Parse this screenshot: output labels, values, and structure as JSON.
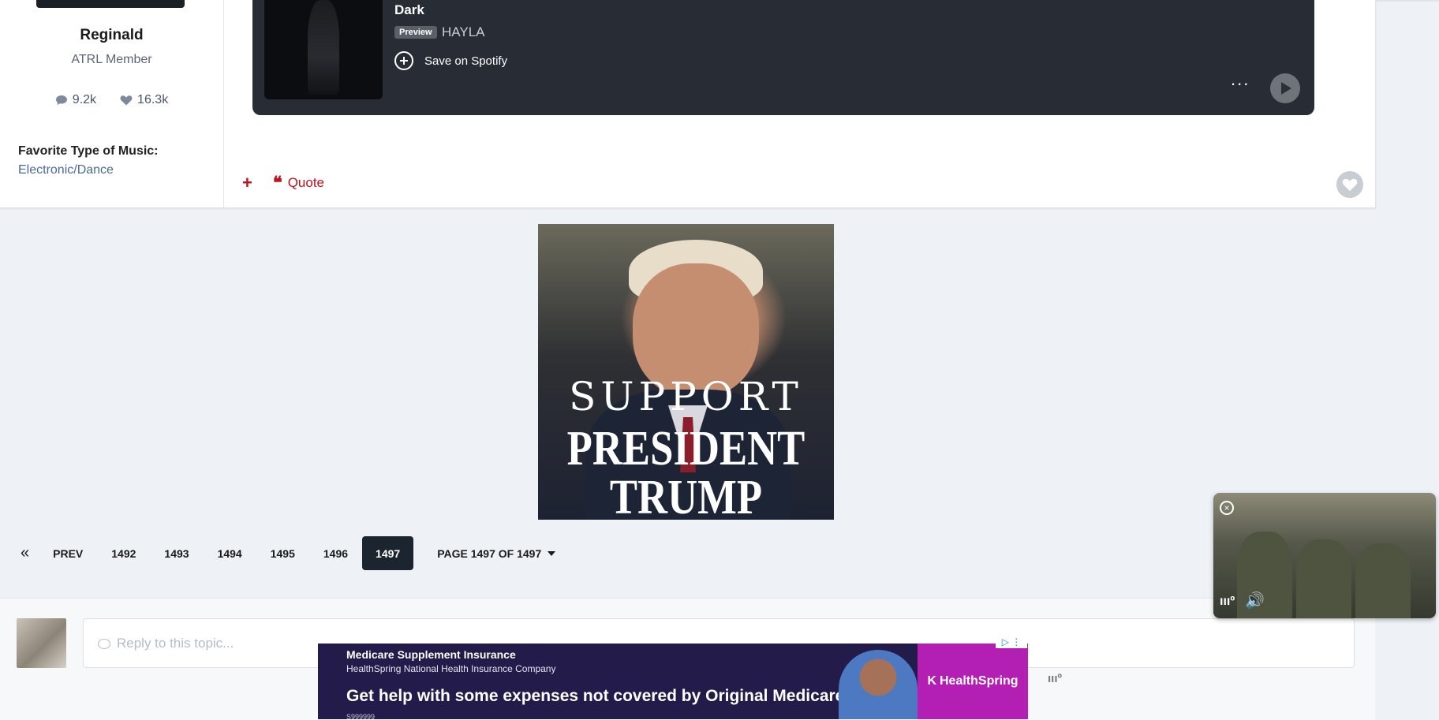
{
  "post": {
    "author": {
      "name": "Reginald",
      "group": "ATRL Member",
      "posts": "9.2k",
      "likes": "16.3k",
      "favorite_label": "Favorite Type of Music:",
      "favorite_value": "Electronic/Dance"
    },
    "spotify": {
      "track": "Dark",
      "preview_badge": "Preview",
      "artist": "HAYLA",
      "save_label": "Save on Spotify",
      "more_label": "..."
    },
    "actions": {
      "add": "+",
      "quote_icon": "❝",
      "quote_label": "Quote"
    }
  },
  "promo_image": {
    "line1": "SUPPORT",
    "line2": "PRESIDENT",
    "line3": "TRUMP"
  },
  "pagination": {
    "first": "«",
    "prev": "PREV",
    "pages": [
      "1492",
      "1493",
      "1494",
      "1495",
      "1496",
      "1497"
    ],
    "active": "1497",
    "jump_label": "PAGE 1497 OF 1497"
  },
  "reply": {
    "placeholder": "Reply to this topic..."
  },
  "video_ad": {
    "close": "×",
    "logo": "ıııº",
    "sound_icon": "🔊"
  },
  "banner_ad": {
    "title": "Medicare Supplement Insurance",
    "subtitle": "HealthSpring National Health Insurance Company",
    "headline": "Get help with some expenses not covered by Original Medicare.",
    "code": "S999999",
    "brand": "HealthSpring",
    "brand_mark": "K",
    "adchoices": "▷ ⋮",
    "side_logo": "ıııº"
  },
  "colors": {
    "accent_red": "#c0121c",
    "pager_active": "#1c2430",
    "spotify_bg": "#282d35"
  }
}
